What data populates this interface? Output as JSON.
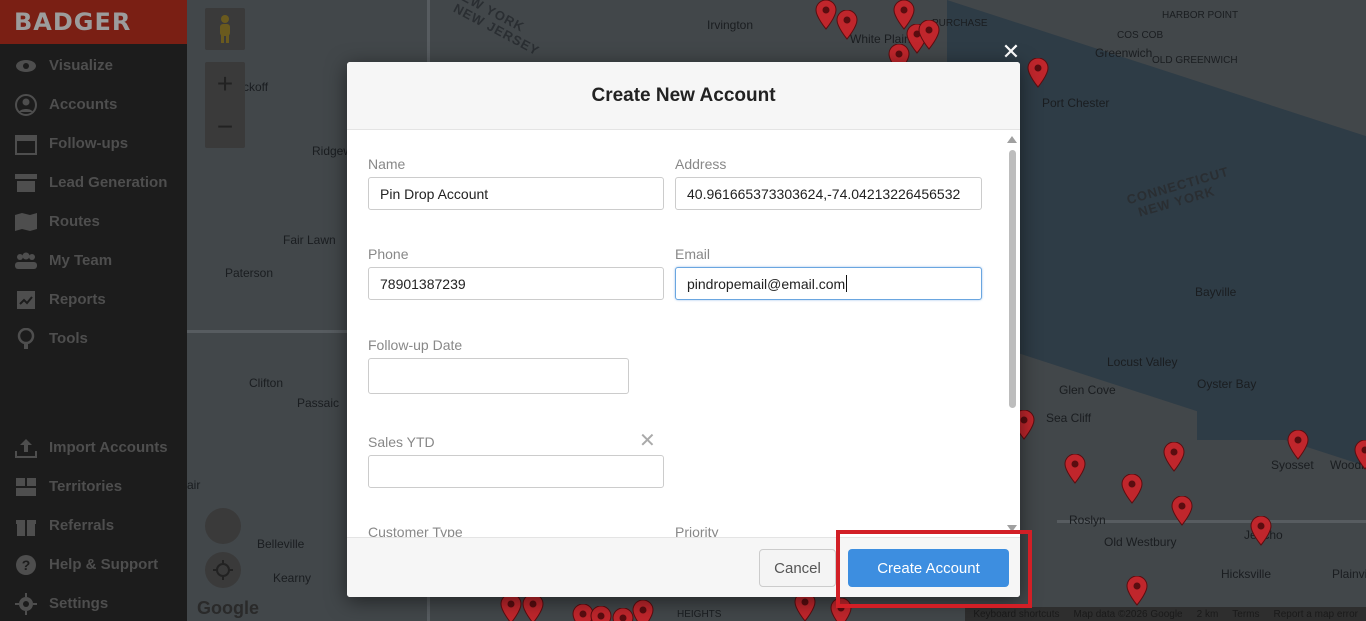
{
  "app": {
    "brand": "BADGER"
  },
  "sidebar": {
    "top_items": [
      {
        "label": "Visualize",
        "icon": "eye-icon"
      },
      {
        "label": "Accounts",
        "icon": "account-icon"
      },
      {
        "label": "Follow-ups",
        "icon": "calendar-icon"
      },
      {
        "label": "Lead Generation",
        "icon": "store-icon"
      },
      {
        "label": "Routes",
        "icon": "map-icon"
      },
      {
        "label": "My Team",
        "icon": "team-icon"
      },
      {
        "label": "Reports",
        "icon": "report-icon"
      },
      {
        "label": "Tools",
        "icon": "tools-icon"
      }
    ],
    "bottom_items": [
      {
        "label": "Import Accounts",
        "icon": "upload-icon"
      },
      {
        "label": "Territories",
        "icon": "territories-icon"
      },
      {
        "label": "Referrals",
        "icon": "gift-icon"
      },
      {
        "label": "Help & Support",
        "icon": "help-icon"
      },
      {
        "label": "Settings",
        "icon": "gear-icon"
      }
    ]
  },
  "map": {
    "labels": [
      "NEW YORK",
      "NEW JERSEY",
      "Irvington",
      "White Plains",
      "PURCHASE",
      "HARBOR POINT",
      "COS COB",
      "Greenwich",
      "OLD GREENWICH",
      "Port Chester",
      "Ridgewood",
      "Fair Lawn",
      "Paterson",
      "Clifton",
      "Passaic",
      "Belleville",
      "Kearny",
      "CONNECTICUT",
      "NEW YORK",
      "Bayville",
      "Locust Valley",
      "Glen Cove",
      "Oyster Bay",
      "Sea Cliff",
      "Syosset",
      "Woodbury",
      "Roslyn",
      "Old Westbury",
      "Jericho",
      "Hicksville",
      "Plainview",
      "HEIGHTS",
      "ckoff",
      "air"
    ],
    "google_logo": "Google",
    "attribution": [
      "Keyboard shortcuts",
      "Map data ©2026 Google",
      "2 km",
      "Terms",
      "Report a map error"
    ],
    "zoom_in_label": "+",
    "zoom_out_label": "−"
  },
  "modal": {
    "title": "Create New Account",
    "close_label": "✕",
    "fields": {
      "name": {
        "label": "Name",
        "value": "Pin Drop Account"
      },
      "address": {
        "label": "Address",
        "value": "40.961665373303624,-74.04213226456532"
      },
      "phone": {
        "label": "Phone",
        "value": "78901387239"
      },
      "email": {
        "label": "Email",
        "value": "pindropemail@email.com"
      },
      "followup_date": {
        "label": "Follow-up Date",
        "value": ""
      },
      "sales_ytd": {
        "label": "Sales YTD",
        "value": ""
      },
      "customer_type": {
        "label": "Customer Type"
      },
      "priority": {
        "label": "Priority"
      }
    },
    "clear_date_label": "✕",
    "cancel_label": "Cancel",
    "create_label": "Create Account"
  },
  "colors": {
    "primary_button": "#3d8ee0",
    "highlight": "#d21f26",
    "pin": "#c0262c"
  }
}
